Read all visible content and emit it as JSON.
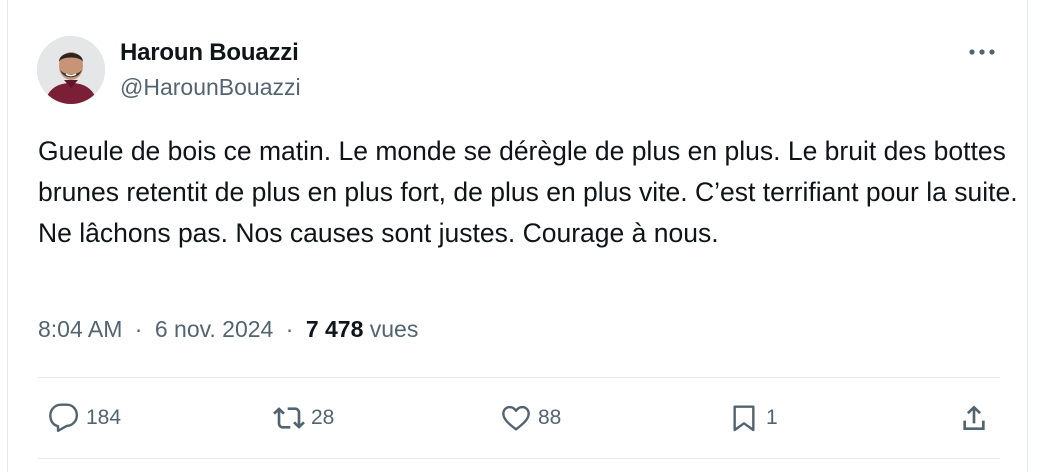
{
  "author": {
    "name": "Haroun Bouazzi",
    "handle": "@HarounBouazzi",
    "avatar_icon": "profile-photo"
  },
  "tweet": {
    "paragraphs": [
      "Gueule de bois ce matin. Le monde se dérègle de plus en plus. Le bruit des bottes brunes retentit de plus en plus fort, de plus en plus vite. C’est terrifiant pour la suite.",
      "Ne lâchons pas. Nos causes sont justes. Courage à nous."
    ]
  },
  "meta": {
    "time": "8:04 AM",
    "date": "6 nov. 2024",
    "separator": "·",
    "views_count": "7 478",
    "views_label": "vues"
  },
  "actions": {
    "reply_count": "184",
    "retweet_count": "28",
    "like_count": "88",
    "bookmark_count": "1"
  },
  "colors": {
    "text": "#0f1419",
    "secondary": "#536471",
    "divider": "#e6e9ec"
  }
}
